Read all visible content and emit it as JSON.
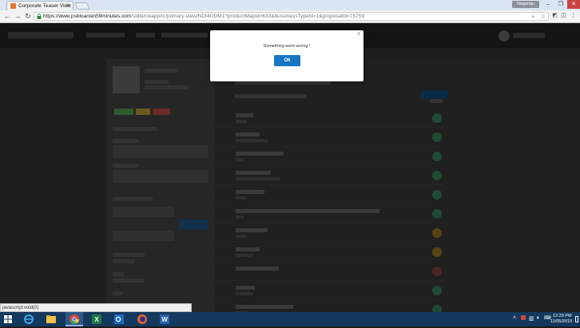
{
  "browser": {
    "tab_title": "Corporate Teaser View",
    "profile_label": "Nagaraju",
    "url_host": "https://www.psbloansin59minutes.com",
    "url_rest": "/sidbi/cwapp/cr/primary-view/NDI4ODM1?productMapId=633&bussinessTypeId=1&proposalId=75759"
  },
  "page": {
    "status_tip": "javascript:void(0)"
  },
  "modal": {
    "close_glyph": "x",
    "message": "Something went wrong !",
    "ok_label": "Ok"
  },
  "taskbar": {
    "apps": [
      "internet-explorer-icon",
      "file-explorer-icon",
      "chrome-icon",
      "excel-icon",
      "outlook-icon",
      "firefox-icon",
      "word-icon"
    ],
    "time": "12:29 PM",
    "date": "11/05/2019"
  },
  "colors": {
    "accent": "#1976c4",
    "taskbar": "#14385e",
    "close": "#c8453e"
  }
}
